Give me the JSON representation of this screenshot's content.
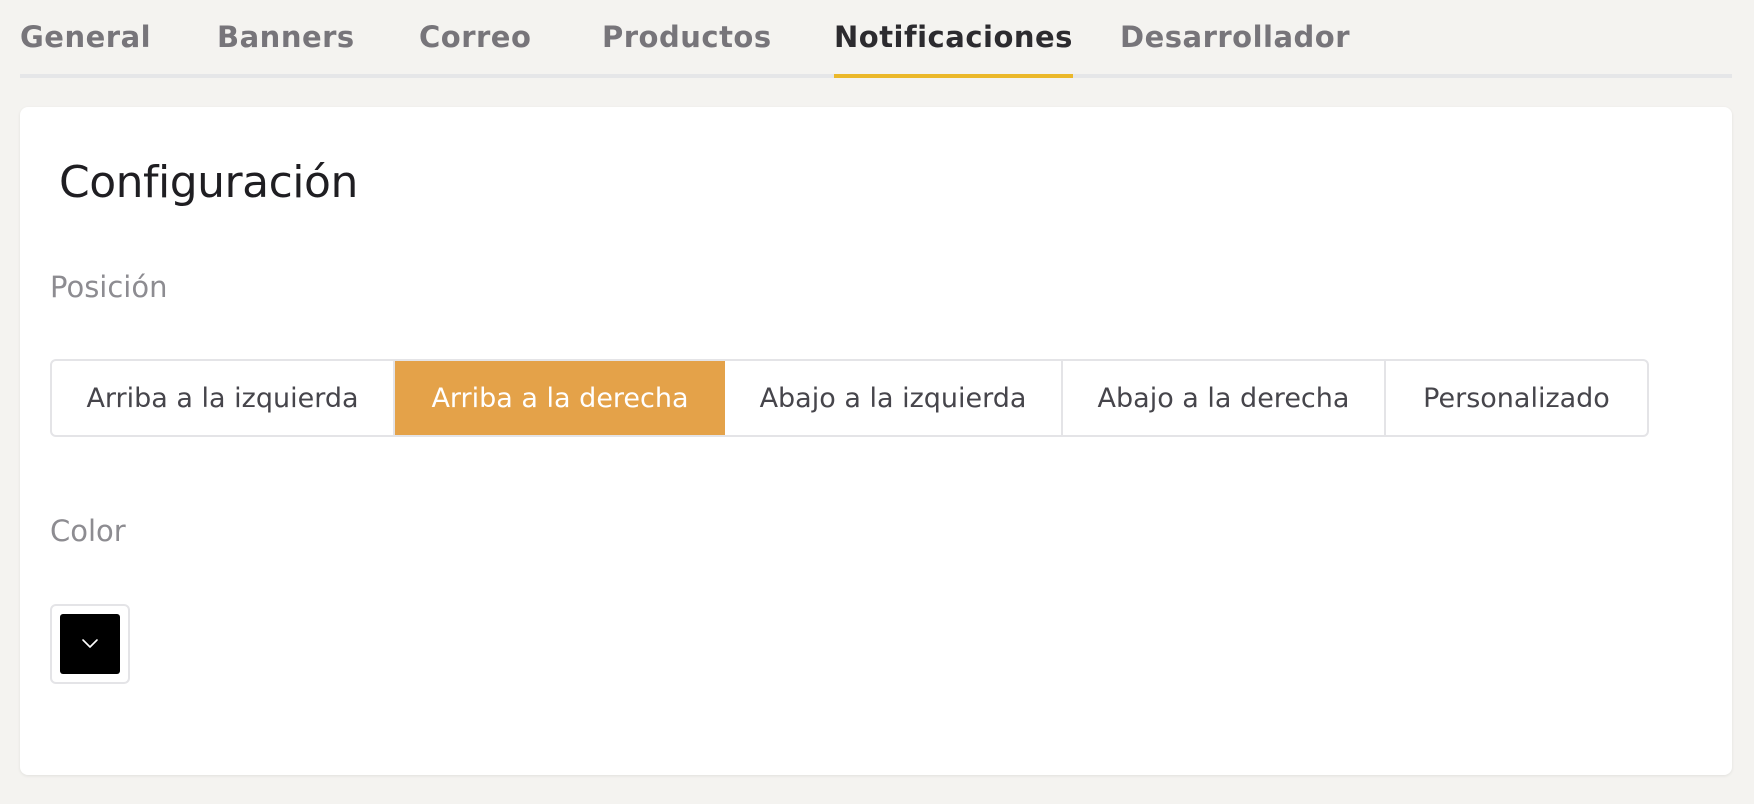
{
  "tabs": [
    {
      "label": "General",
      "active": false
    },
    {
      "label": "Banners",
      "active": false
    },
    {
      "label": "Correo",
      "active": false
    },
    {
      "label": "Productos",
      "active": false
    },
    {
      "label": "Notificaciones",
      "active": true
    },
    {
      "label": "Desarrollador",
      "active": false
    }
  ],
  "card": {
    "title": "Configuración",
    "position": {
      "label": "Posición",
      "options": [
        "Arriba a la izquierda",
        "Arriba a la derecha",
        "Abajo a la izquierda",
        "Abajo a la derecha",
        "Personalizado"
      ],
      "selected": "Arriba a la derecha"
    },
    "color": {
      "label": "Color",
      "value": "#000000",
      "icon": "chevron-down-icon"
    }
  },
  "colors": {
    "accent": "#ebb82a",
    "selected_option": "#e4a249"
  }
}
